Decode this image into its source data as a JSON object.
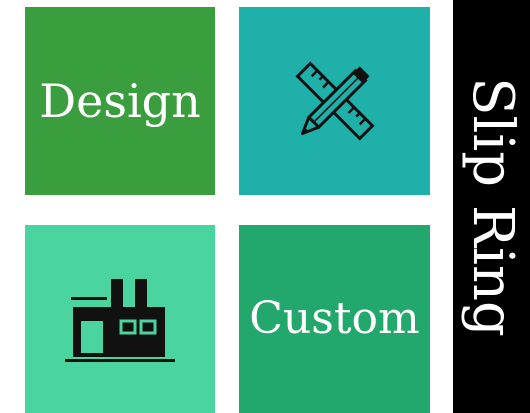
{
  "tiles": {
    "design": {
      "label": "Design",
      "color": "#3a9e3f"
    },
    "tools": {
      "icon": "ruler-pencil-icon",
      "color": "#1fb0aa"
    },
    "factory": {
      "icon": "factory-icon",
      "color": "#49d4a0"
    },
    "custom": {
      "label": "Custom",
      "color": "#22a86c"
    }
  },
  "side_banner": {
    "text": "Slip Ring",
    "color": "#000000"
  }
}
